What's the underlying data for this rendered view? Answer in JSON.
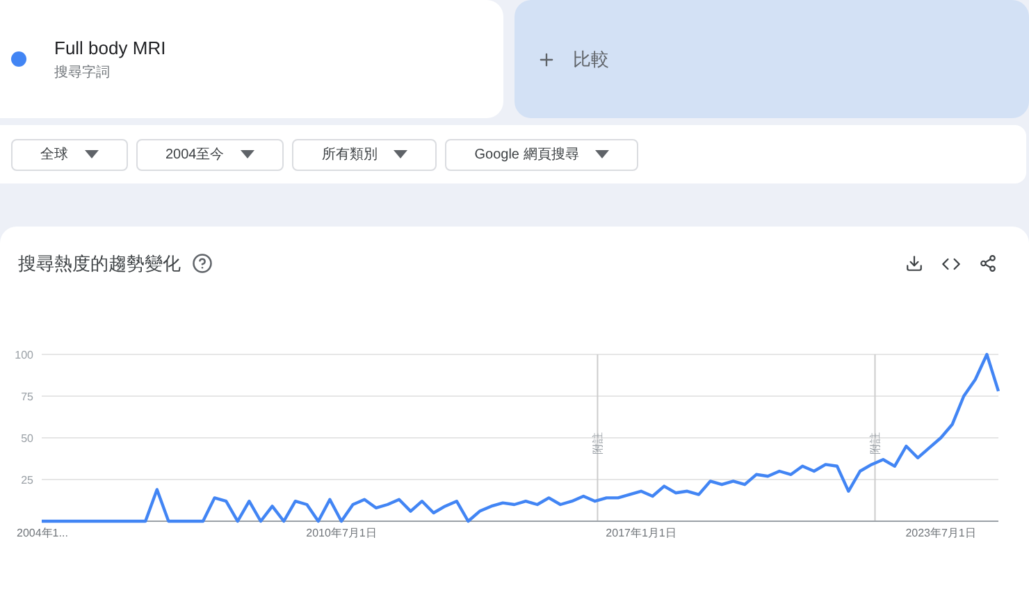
{
  "term": {
    "name": "Full body MRI",
    "subtitle": "搜尋字詞",
    "color": "#4285f4"
  },
  "compare": {
    "label": "比較"
  },
  "filters": [
    {
      "label": "全球"
    },
    {
      "label": "2004至今"
    },
    {
      "label": "所有類別"
    },
    {
      "label": "Google 網頁搜尋"
    }
  ],
  "trend": {
    "title": "搜尋熱度的趨勢變化",
    "chart_data": {
      "type": "line",
      "categories": [
        "2004年1...",
        null,
        null,
        null,
        null,
        null,
        null,
        null,
        null,
        null,
        null,
        null,
        null,
        null,
        null,
        null,
        null,
        null,
        null,
        null,
        null,
        null,
        null,
        null,
        null,
        null,
        "2010年7月1日",
        null,
        null,
        null,
        null,
        null,
        null,
        null,
        null,
        null,
        null,
        null,
        null,
        null,
        null,
        null,
        null,
        null,
        null,
        null,
        null,
        null,
        null,
        null,
        null,
        null,
        "2017年1月1日",
        null,
        null,
        null,
        null,
        null,
        null,
        null,
        null,
        null,
        null,
        null,
        null,
        null,
        null,
        null,
        null,
        null,
        null,
        null,
        null,
        null,
        null,
        null,
        null,
        null,
        "2023年7月1日",
        null,
        null,
        null,
        null,
        null
      ],
      "series": [
        {
          "color": "#4285f4",
          "values": [
            0,
            0,
            0,
            0,
            0,
            0,
            0,
            0,
            0,
            0,
            19,
            0,
            0,
            0,
            0,
            14,
            12,
            0,
            12,
            0,
            9,
            0,
            12,
            10,
            0,
            13,
            0,
            10,
            13,
            8,
            10,
            13,
            6,
            12,
            5,
            9,
            12,
            0,
            6,
            9,
            11,
            10,
            12,
            10,
            14,
            10,
            12,
            15,
            12,
            14,
            14,
            16,
            18,
            15,
            21,
            17,
            18,
            16,
            24,
            22,
            24,
            22,
            28,
            27,
            30,
            28,
            33,
            30,
            34,
            33,
            18,
            30,
            34,
            37,
            33,
            45,
            38,
            44,
            50,
            58,
            75,
            85,
            100,
            78
          ]
        }
      ],
      "ylim": [
        0,
        100
      ],
      "yticks": [
        25,
        50,
        75,
        100
      ],
      "grid": true,
      "annotations": [
        "附註",
        "附註"
      ]
    }
  }
}
